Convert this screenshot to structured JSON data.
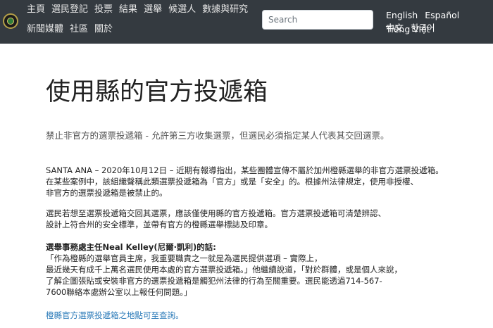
{
  "nav": {
    "row1": [
      "主頁",
      "選民登記",
      "投票",
      "結果",
      "選舉",
      "候選人",
      "數據與研究"
    ],
    "row2": [
      "新聞媒體",
      "社區",
      "關於"
    ],
    "search_placeholder": "Search",
    "languages_row1": [
      "English",
      "Español",
      "Tiếng Việt"
    ],
    "languages_row2": [
      "中文",
      "한국어"
    ]
  },
  "page": {
    "title": "使用縣的官方投遞箱",
    "lead": "禁止非官方的選票投遞箱 - 允許第三方收集選票，但選民必須指定某人代表其交回選票。",
    "paragraph1": [
      "SANTA ANA – 2020年10月12日 – 近期有報導指出，某些團體宣傳不屬於加州橙縣選舉的非官方選票投遞箱。",
      "在某些案例中，該組織聲稱此類選票投遞箱為「官方」或是「安全」的。根據州法律規定，使用非授權、",
      "非官方的選票投遞箱是被禁止的。"
    ],
    "paragraph2": [
      "選民若想至選票投遞箱交回其選票，應該僅使用縣的官方投遞箱。官方選票投遞箱可清楚辨認、",
      "設計上符合州的安全標準，並帶有官方的橙縣選舉標誌及印章。"
    ],
    "quote_heading": "選舉事務處主任Neal Kelley(尼爾·凱利)的話:",
    "quote_lines": [
      "「作為橙縣的選舉官員主席，我重要職責之一就是為選民提供選項 – 實際上，",
      "最近幾天有成千上萬名選民使用本處的官方選票投遞箱。」他繼續說道，「對於群體，或是個人來說，",
      "了解企圖張貼或安裝非官方的選票投遞箱是觸犯州法律的行為至關重要。選民能透過714-567-",
      "7600聯絡本處辦公室以上報任何問題。」"
    ],
    "link_text": "橙縣官方選票投遞箱之地點可至查詢。"
  }
}
